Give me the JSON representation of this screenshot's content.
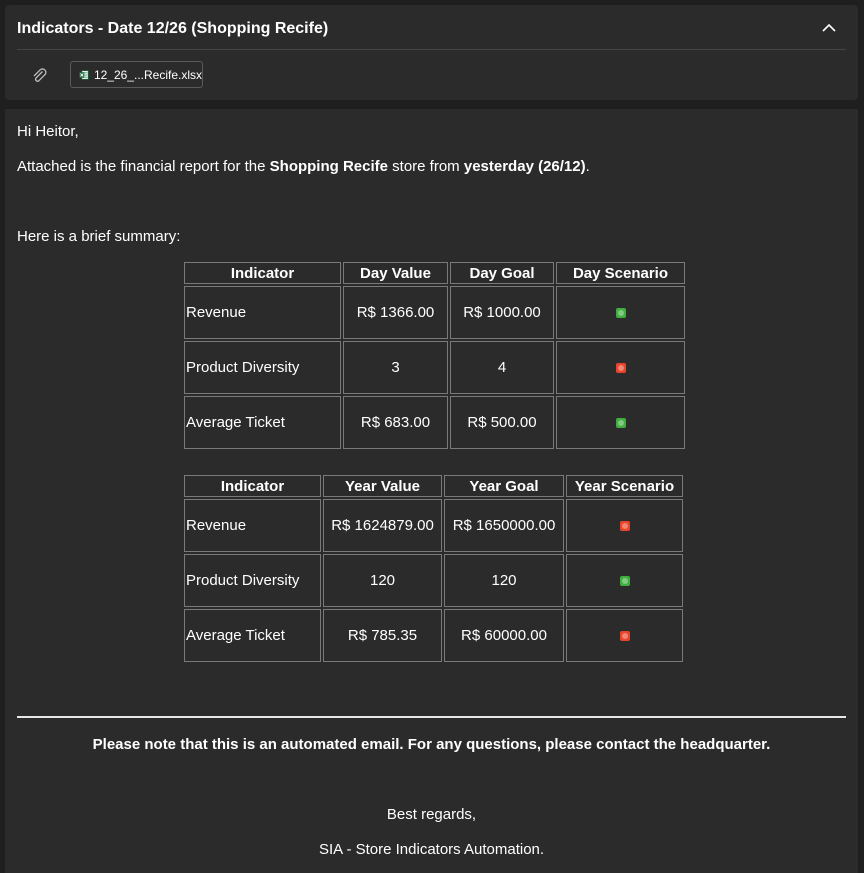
{
  "email": {
    "subject": "Indicators - Date 12/26 (Shopping Recife)",
    "attachment_name": "12_26_...Recife.xlsx",
    "greeting": "Hi Heitor,",
    "intro": {
      "part1": "Attached is the financial report for the ",
      "store": "Shopping Recife",
      "part2": " store from ",
      "when": "yesterday (26/12)",
      "part3": "."
    },
    "summary_intro": "Here is a brief summary:",
    "notice": "Please note that this is an automated email. For any questions, please contact the headquarter.",
    "regards": "Best regards,",
    "signature": "SIA - Store Indicators Automation."
  },
  "colors": {
    "green": "#3fae3f",
    "red": "#e8442c"
  },
  "day_table": {
    "headers": [
      "Indicator",
      "Day Value",
      "Day Goal",
      "Day Scenario"
    ],
    "rows": [
      {
        "indicator": "Revenue",
        "value": "R$ 1366.00",
        "goal": "R$ 1000.00",
        "scenario": "green"
      },
      {
        "indicator": "Product Diversity",
        "value": "3",
        "goal": "4",
        "scenario": "red"
      },
      {
        "indicator": "Average Ticket",
        "value": "R$ 683.00",
        "goal": "R$ 500.00",
        "scenario": "green"
      }
    ]
  },
  "year_table": {
    "headers": [
      "Indicator",
      "Year Value",
      "Year Goal",
      "Year Scenario"
    ],
    "rows": [
      {
        "indicator": "Revenue",
        "value": "R$ 1624879.00",
        "goal": "R$ 1650000.00",
        "scenario": "red"
      },
      {
        "indicator": "Product Diversity",
        "value": "120",
        "goal": "120",
        "scenario": "green"
      },
      {
        "indicator": "Average Ticket",
        "value": "R$ 785.35",
        "goal": "R$ 60000.00",
        "scenario": "red"
      }
    ]
  }
}
